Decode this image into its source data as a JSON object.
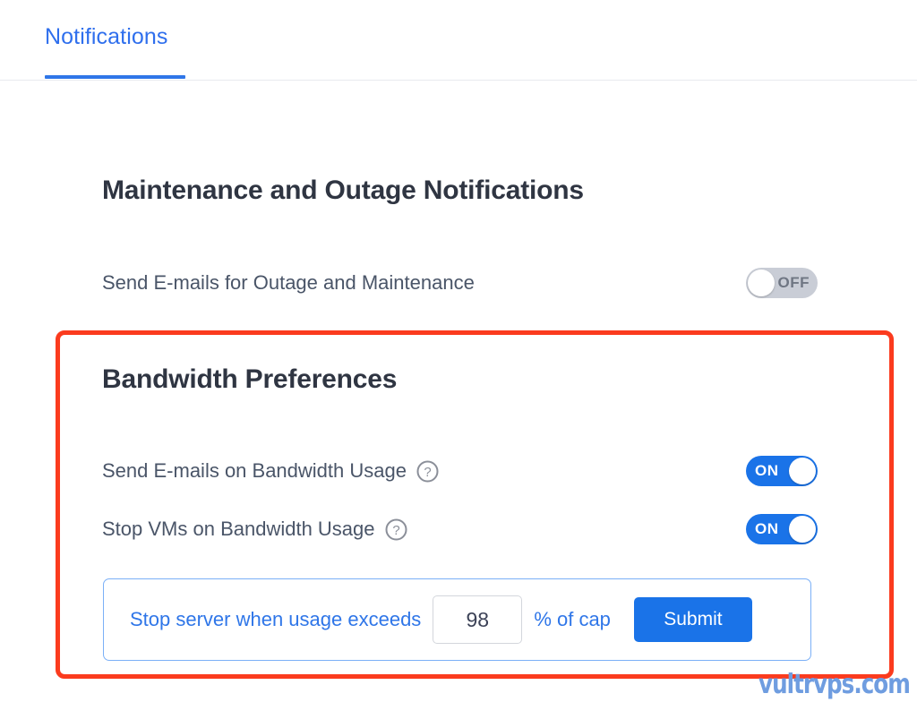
{
  "tabs": [
    {
      "label": "Notifications",
      "active": true
    }
  ],
  "accent_colors": {
    "tab_blue": "#2f6fed",
    "toggle_on_blue": "#1a73e8",
    "toggle_off_gray": "#c9cdd6",
    "submit_blue": "#1a73e8",
    "highlight_red": "#fb3b1e",
    "panel_border_blue": "#7bb0f7"
  },
  "maintenance_section": {
    "title": "Maintenance and Outage Notifications",
    "row": {
      "label": "Send E-mails for Outage and Maintenance",
      "toggle_state": "OFF"
    }
  },
  "bandwidth_section": {
    "title": "Bandwidth Preferences",
    "rows": [
      {
        "label": "Send E-mails on Bandwidth Usage",
        "help_icon": "question-mark-circle-icon",
        "toggle_state": "ON"
      },
      {
        "label": "Stop VMs on Bandwidth Usage",
        "help_icon": "question-mark-circle-icon",
        "toggle_state": "ON"
      }
    ],
    "usage_panel": {
      "prefix_text": "Stop server when usage exceeds",
      "input_value": "98",
      "input_placeholder": "",
      "suffix_text": "% of cap",
      "submit_label": "Submit"
    }
  },
  "watermark": {
    "text": "vultrvps.com"
  }
}
